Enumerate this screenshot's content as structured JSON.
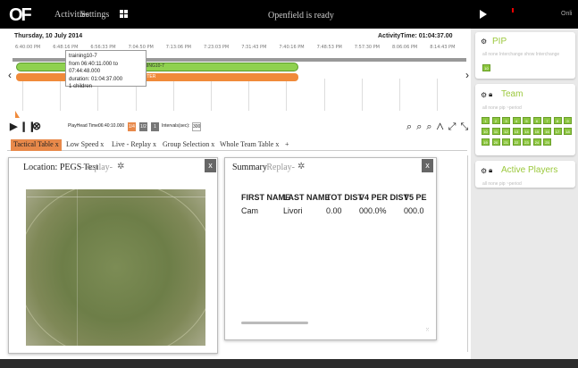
{
  "app": {
    "logo": "OF",
    "status": "Openfield is ready",
    "online": "Onli",
    "nav": [
      "Activities",
      "Settings"
    ]
  },
  "timeline": {
    "date": "Thursday, 10 July 2014",
    "activity_time": "ActivityTime: 01:04:37.00",
    "ticks": [
      "6:40:00 PM",
      "6:48:16 PM",
      "6:56:33 PM",
      "7:04:50 PM",
      "7:13:06 PM",
      "7:23:03 PM",
      "7:31:43 PM",
      "7:40:16 PM",
      "7:48:53 PM",
      "7:57:30 PM",
      "8:06:06 PM",
      "8:14:43 PM"
    ],
    "bar1_label": "TRAINING10-7",
    "bar2_label": "QUARTER",
    "tooltip": {
      "name": "training10-7",
      "range": "from 06:40:11.000 to 07:44:48.000",
      "duration": "duration: 01:04:37.000",
      "children": "1 children"
    },
    "playhead_label": "PlayHead Time:",
    "playhead_value": "06:40:10.000",
    "sq": [
      "1/4",
      "1/2",
      "1"
    ],
    "interval_label": "Intervals(sec):",
    "interval_value": "300",
    "ctrl_play": "▶",
    "ctrl_pause": "❙❙",
    "ctrl_stop": "⊗",
    "tools": "⌕ ⌕ ⌕ ⋀ ⤢ ⤡"
  },
  "tabs": [
    "Tactical Table x",
    "Low Speed x",
    "Live - Replay x",
    "Group Selection x",
    "Whole Team Table x",
    "+"
  ],
  "panel1": {
    "title": "Location: PEGS Test",
    "mode": "-Replay-",
    "close": "x"
  },
  "panel2": {
    "title": "Summary",
    "mode": "-Replay-",
    "close": "x",
    "headers": [
      "FIRST NAME",
      "LAST NAME",
      "TOT DIST",
      "V4 PER DIST",
      "V5 PE"
    ],
    "rows": [
      [
        "Cam",
        "Livori",
        "0.00",
        "000.0%",
        "000.0"
      ]
    ]
  },
  "right": {
    "pip": {
      "title": "PIP",
      "sub": "all none Interchange show Interchange",
      "chips": [
        "10"
      ]
    },
    "team": {
      "title": "Team",
      "sub": "all none pip ~period",
      "chips": [
        "1",
        "2",
        "3",
        "4",
        "5",
        "6",
        "7",
        "8",
        "9",
        "10",
        "11",
        "12",
        "13",
        "14",
        "15",
        "16",
        "17",
        "18",
        "19",
        "20",
        "21",
        "22",
        "23",
        "24",
        "25"
      ]
    },
    "active": {
      "title": "Active Players",
      "sub": "all none pip ~period"
    }
  },
  "colors": {
    "accent_orange": "#e8894a",
    "accent_green": "#8cc63f"
  }
}
